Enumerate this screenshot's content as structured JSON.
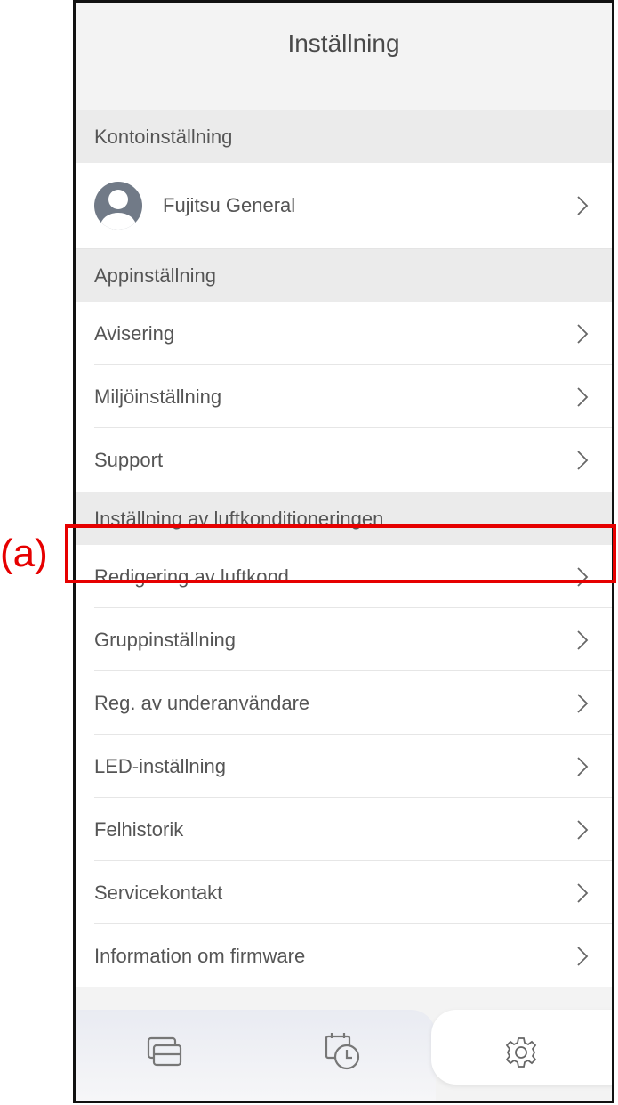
{
  "annotation": {
    "label": "(a)"
  },
  "header": {
    "title": "Inställning"
  },
  "account_section": {
    "title": "Kontoinställning",
    "user_name": "Fujitsu General"
  },
  "app_section": {
    "title": "Appinställning",
    "items": [
      {
        "label": "Avisering"
      },
      {
        "label": "Miljöinställning"
      },
      {
        "label": "Support"
      }
    ]
  },
  "ac_section": {
    "title": "Inställning av luftkonditioneringen",
    "items": [
      {
        "label": "Redigering av luftkond."
      },
      {
        "label": "Gruppinställning"
      },
      {
        "label": "Reg. av underanvändare"
      },
      {
        "label": "LED-inställning"
      },
      {
        "label": "Felhistorik"
      },
      {
        "label": "Servicekontakt"
      },
      {
        "label": "Information om firmware"
      }
    ]
  },
  "tabbar": {
    "tabs": [
      {
        "icon": "devices-icon"
      },
      {
        "icon": "timer-icon"
      },
      {
        "icon": "gear-icon",
        "selected": true
      }
    ]
  },
  "colors": {
    "highlight": "#e60000",
    "text": "#555555",
    "section_bg": "#ebebeb",
    "avatar": "#717a87"
  }
}
